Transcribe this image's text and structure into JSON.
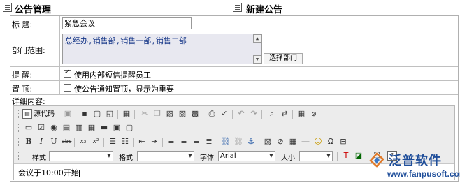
{
  "header": {
    "left_title": "公告管理",
    "center_title": "新建公告"
  },
  "form": {
    "title": {
      "label": "标    题:",
      "value": "紧急会议"
    },
    "department": {
      "label": "部门范围:",
      "value": "总经办,销售部,销售一部,销售二部",
      "select_button": "选择部门"
    },
    "remind": {
      "label": "提    醒:",
      "checkbox_label": "使用内部短信提醒员工",
      "checked": true
    },
    "pin": {
      "label": "置    顶:",
      "checkbox_label": "使公告通知置顶，显示为重要",
      "checked": false
    },
    "detail": {
      "label": "详细内容:"
    }
  },
  "editor": {
    "source_label": "源代码",
    "style_label": "样式",
    "format_label": "格式",
    "font_label": "字体",
    "font_value": "Arial",
    "size_label": "大小",
    "content": "会议于10:00开始"
  },
  "watermark": {
    "brand": "泛普软件",
    "url": "www.fanpusoft.com",
    "color": "#1f4e9a"
  }
}
